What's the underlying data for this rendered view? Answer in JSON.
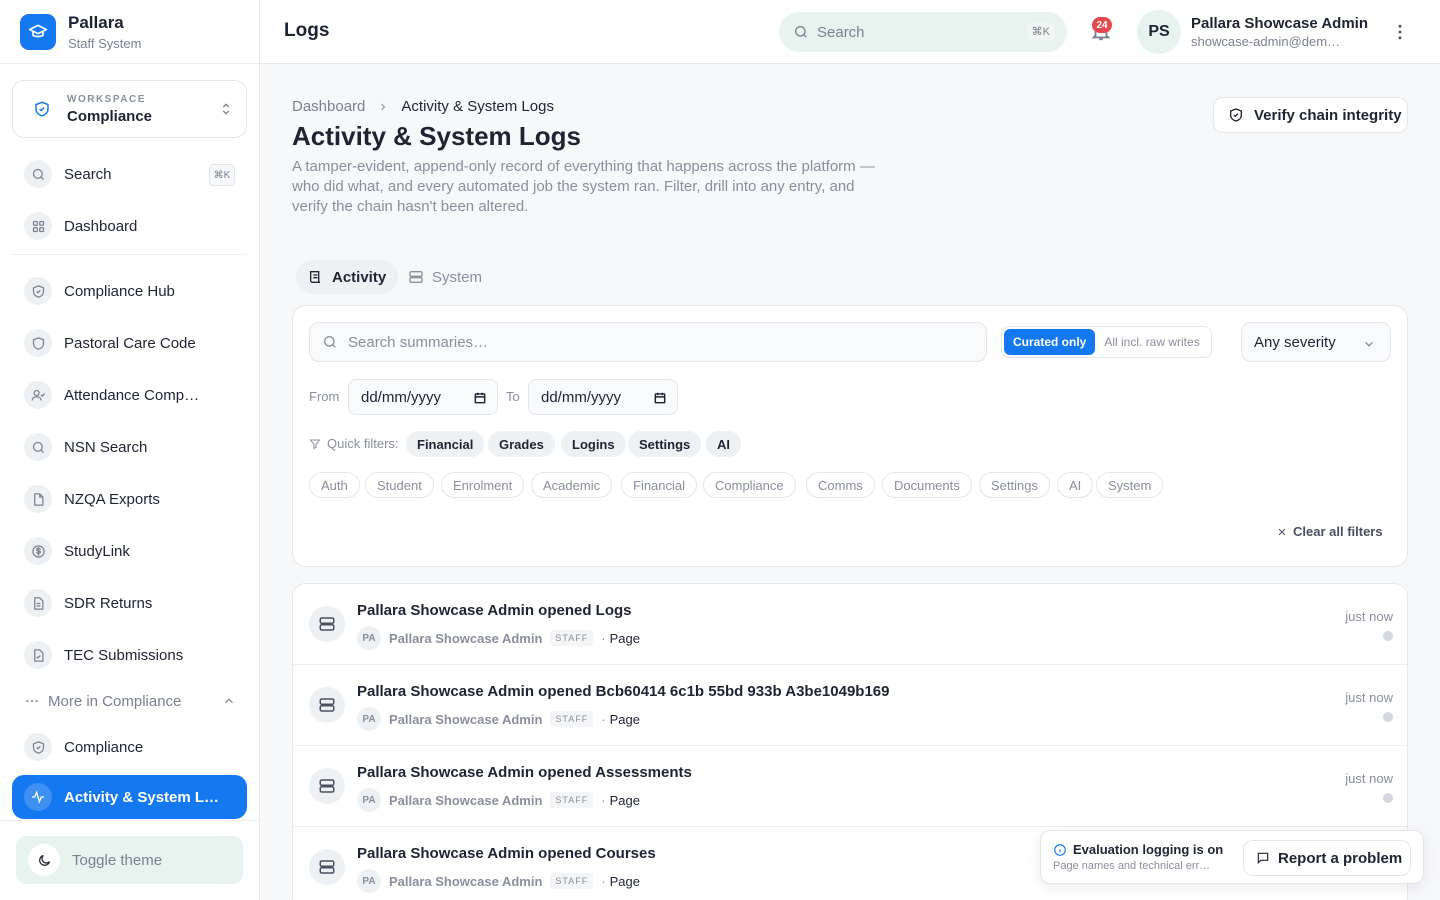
{
  "brand": {
    "name": "Pallara",
    "subtitle": "Staff System",
    "logo_icon": "graduation-cap-icon"
  },
  "workspace": {
    "label": "WORKSPACE",
    "value": "Compliance"
  },
  "sidebar": {
    "search": {
      "label": "Search",
      "shortcut": "⌘K"
    },
    "items": [
      {
        "label": "Dashboard",
        "icon": "grid-icon"
      },
      {
        "label": "Compliance Hub",
        "icon": "shield-check-icon"
      },
      {
        "label": "Pastoral Care Code",
        "icon": "shield-icon"
      },
      {
        "label": "Attendance Comp…",
        "icon": "user-check-icon"
      },
      {
        "label": "NSN Search",
        "icon": "search-icon"
      },
      {
        "label": "NZQA Exports",
        "icon": "file-icon"
      },
      {
        "label": "StudyLink",
        "icon": "dollar-circle-icon"
      },
      {
        "label": "SDR Returns",
        "icon": "file-text-icon"
      },
      {
        "label": "TEC Submissions",
        "icon": "file-check-icon"
      }
    ],
    "more_label": "More in Compliance",
    "compliance_label": "Compliance",
    "active_label": "Activity & System L…",
    "toggle_theme": "Toggle theme"
  },
  "header": {
    "title": "Logs",
    "search_placeholder": "Search",
    "search_shortcut": "⌘K",
    "notification_count": "24",
    "user_initials": "PS",
    "user_name": "Pallara Showcase Admin",
    "user_email": "showcase-admin@dem…"
  },
  "breadcrumb": {
    "parent": "Dashboard",
    "current": "Activity & System Logs"
  },
  "page": {
    "title": "Activity & System Logs",
    "description": "A tamper-evident, append-only record of everything that happens across the platform — who did what, and every automated job the system ran. Filter, drill into any entry, and verify the chain hasn't been altered.",
    "verify_button": "Verify chain integrity"
  },
  "tabs": [
    {
      "label": "Activity",
      "active": true
    },
    {
      "label": "System",
      "active": false
    }
  ],
  "filters": {
    "search_placeholder": "Search summaries…",
    "mode_on": "Curated only",
    "mode_off": "All incl. raw writes",
    "severity": "Any severity",
    "from_label": "From",
    "to_label": "To",
    "date_placeholder": "dd/mm/yyyy",
    "quick_label": "Quick filters:",
    "quick": [
      "Financial",
      "Grades",
      "Logins",
      "Settings",
      "AI"
    ],
    "categories": [
      "Auth",
      "Student",
      "Enrolment",
      "Academic",
      "Financial",
      "Compliance",
      "Comms",
      "Documents",
      "Settings",
      "AI",
      "System"
    ],
    "clear_all": "Clear all filters"
  },
  "logs": [
    {
      "title": "Pallara Showcase Admin opened Logs",
      "actor_initials": "PA",
      "actor": "Pallara Showcase Admin",
      "role": "STAFF",
      "type": "Page",
      "time": "just now"
    },
    {
      "title": "Pallara Showcase Admin opened Bcb60414 6c1b 55bd 933b A3be1049b169",
      "actor_initials": "PA",
      "actor": "Pallara Showcase Admin",
      "role": "STAFF",
      "type": "Page",
      "time": "just now"
    },
    {
      "title": "Pallara Showcase Admin opened Assessments",
      "actor_initials": "PA",
      "actor": "Pallara Showcase Admin",
      "role": "STAFF",
      "type": "Page",
      "time": "just now"
    },
    {
      "title": "Pallara Showcase Admin opened Courses",
      "actor_initials": "PA",
      "actor": "Pallara Showcase Admin",
      "role": "STAFF",
      "type": "Page",
      "time": ""
    }
  ],
  "toast": {
    "title": "Evaluation logging is on",
    "subtitle": "Page names and technical err…",
    "report_button": "Report a problem"
  },
  "colors": {
    "accent": "#1479f0",
    "mint": "#e6f3ef",
    "badge": "#e5484d"
  }
}
